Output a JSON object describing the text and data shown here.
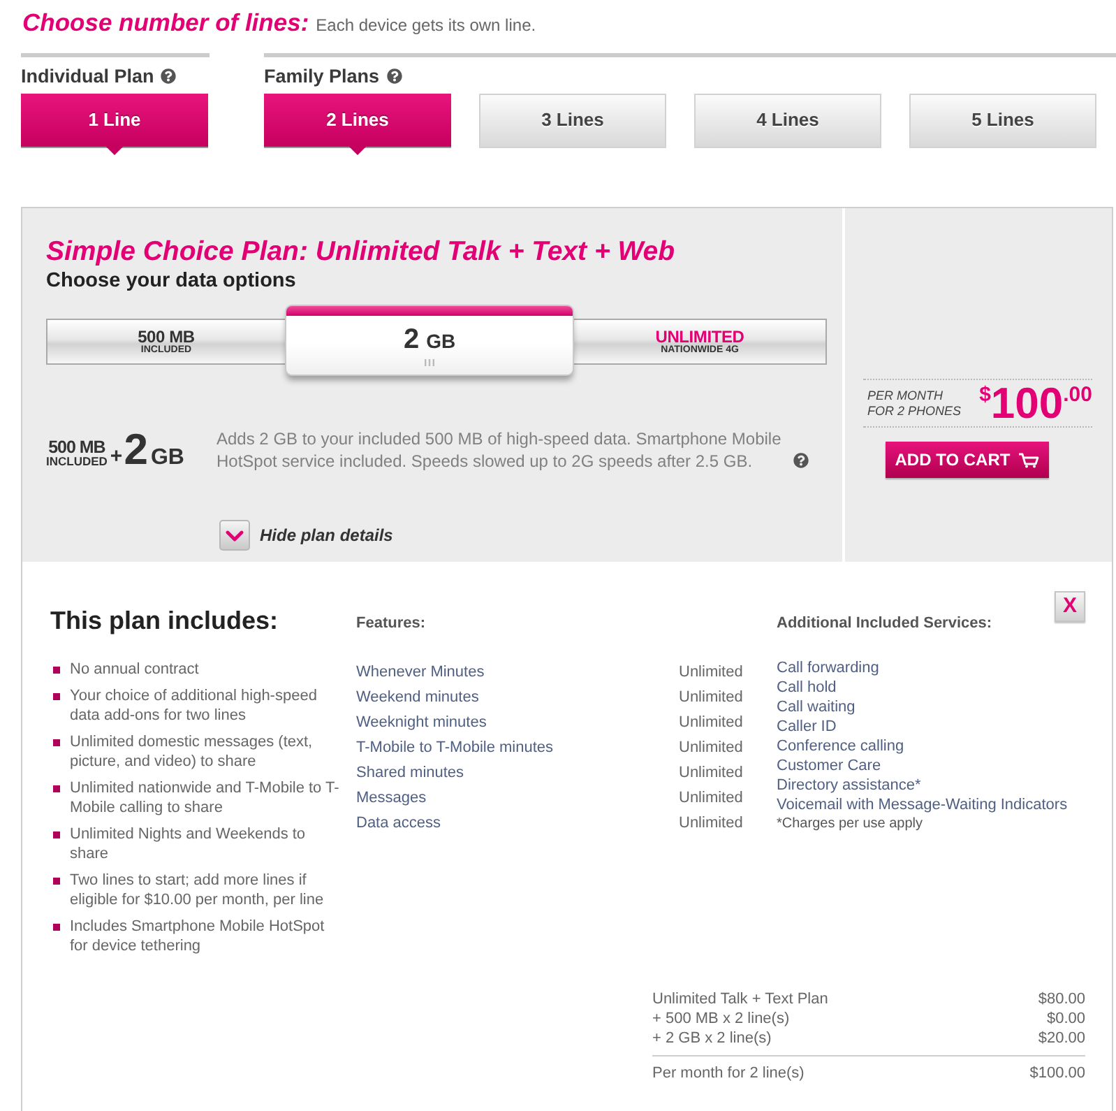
{
  "header": {
    "title": "Choose number of lines:",
    "subtitle": "Each device gets its own line."
  },
  "plan_groups": [
    {
      "label": "Individual Plan",
      "options": [
        {
          "label": "1 Line",
          "selected": true
        }
      ]
    },
    {
      "label": "Family Plans",
      "options": [
        {
          "label": "2 Lines",
          "selected": true
        },
        {
          "label": "3 Lines",
          "selected": false
        },
        {
          "label": "4 Lines",
          "selected": false
        },
        {
          "label": "5 Lines",
          "selected": false
        }
      ]
    }
  ],
  "plan": {
    "title": "Simple Choice Plan: Unlimited Talk + Text + Web",
    "subtitle": "Choose your data options",
    "data_options": [
      {
        "kind": "capacity",
        "value": "500",
        "unit": "MB",
        "note": "INCLUDED",
        "selected": false
      },
      {
        "kind": "capacity",
        "value": "2",
        "unit": "GB",
        "selected": true
      },
      {
        "kind": "unlimited",
        "value": "UNLIMITED",
        "note": "NATIONWIDE 4G",
        "selected": false
      }
    ],
    "summary": {
      "included_amount": "500 MB",
      "included_note": "INCLUDED",
      "plus": "+",
      "addon_value": "2",
      "addon_unit": "GB"
    },
    "description": "Adds 2 GB to your included 500 MB of high-speed data. Smartphone Mobile HotSpot service included. Speeds slowed up to 2G speeds after 2.5 GB.",
    "details_toggle": {
      "label": "Hide plan details",
      "expanded": true
    }
  },
  "pricing": {
    "caption": [
      "PER MONTH",
      "FOR 2 PHONES"
    ],
    "currency": "$",
    "amount": "100",
    "cents": ".00",
    "add_to_cart": "ADD TO CART"
  },
  "details": {
    "title": "This plan includes:",
    "includes": [
      "No annual contract",
      "Your choice of additional high-speed data add-ons for two lines",
      "Unlimited domestic messages (text, picture, and video) to share",
      "Unlimited nationwide and T-Mobile to T-Mobile calling to share",
      "Unlimited Nights and Weekends to share",
      "Two lines to start; add more lines if eligible for $10.00 per month, per line",
      "Includes Smartphone Mobile HotSpot for device tethering"
    ],
    "features": {
      "heading": "Features:",
      "rows": [
        {
          "name": "Whenever Minutes",
          "value": "Unlimited"
        },
        {
          "name": "Weekend minutes",
          "value": "Unlimited"
        },
        {
          "name": "Weeknight minutes",
          "value": "Unlimited"
        },
        {
          "name": "T-Mobile to T-Mobile minutes",
          "value": "Unlimited"
        },
        {
          "name": "Shared minutes",
          "value": "Unlimited"
        },
        {
          "name": "Messages",
          "value": "Unlimited"
        },
        {
          "name": "Data access",
          "value": "Unlimited"
        }
      ]
    },
    "services": {
      "heading": "Additional Included Services:",
      "items": [
        "Call forwarding",
        "Call hold",
        "Call waiting",
        "Caller ID",
        "Conference calling",
        "Customer Care",
        "Directory assistance*",
        "Voicemail with Message-Waiting Indicators"
      ],
      "note": "*Charges per use apply"
    },
    "close_label": "X",
    "totals": {
      "rows": [
        {
          "label": "Unlimited Talk + Text Plan",
          "amount": "$80.00"
        },
        {
          "label": "+ 500 MB x 2 line(s)",
          "amount": "$0.00"
        },
        {
          "label": "+ 2 GB x 2 line(s)",
          "amount": "$20.00"
        }
      ],
      "total": {
        "label": "Per month for 2 line(s)",
        "amount": "$100.00"
      }
    }
  }
}
